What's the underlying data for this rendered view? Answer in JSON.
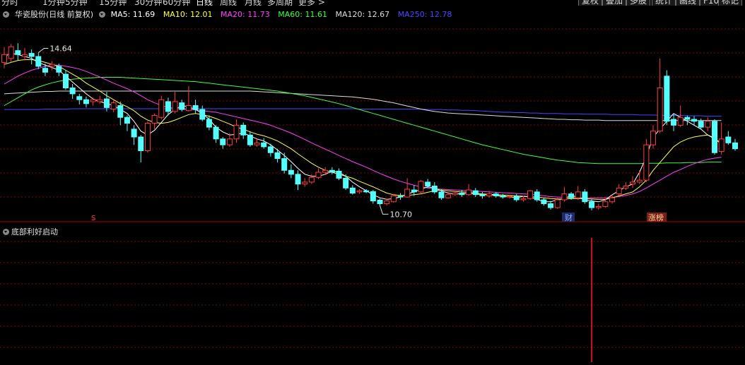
{
  "toolbar": {
    "tabs": [
      {
        "label": "分时",
        "active": false
      },
      {
        "label": "1分钟",
        "active": false
      },
      {
        "label": "5分钟",
        "active": false
      },
      {
        "label": "15分钟",
        "active": false
      },
      {
        "label": "30分钟",
        "active": false
      },
      {
        "label": "60分钟",
        "active": false
      },
      {
        "label": "日线",
        "active": true
      },
      {
        "label": "周线",
        "active": false
      },
      {
        "label": "月线",
        "active": false
      },
      {
        "label": "多周期",
        "active": false
      },
      {
        "label": "更多",
        "active": false
      }
    ],
    "right_buttons": [
      "复权",
      "叠加",
      "多股",
      "统计",
      "画线",
      "F10",
      "标记"
    ]
  },
  "legend": {
    "title": "华瓷股份(日线 前复权)",
    "ma5": "MA5: 11.69",
    "ma10": "MA10: 12.01",
    "ma20": "MA20: 11.73",
    "ma60": "MA60: 11.61",
    "ma120": "MA120: 12.67",
    "ma250": "MA250: 12.78"
  },
  "colors": {
    "up": "#ff3b3b",
    "down": "#54ffff",
    "ma5": "#ffffff",
    "ma10": "#ffff3c",
    "ma20": "#ff3cff",
    "ma60": "#3cff3c",
    "ma120": "#dcdcdc",
    "ma250": "#4646ff",
    "grid": "#8b0000"
  },
  "annotations": {
    "high_label": "14.64",
    "low_label": "10.70",
    "marker_s": "S",
    "marker_cai": "财",
    "marker_zhangting": "涨榜"
  },
  "indicator": {
    "title": "底部利好启动"
  },
  "chart_data": {
    "type": "candlestick",
    "y_range": [
      10.2,
      15.2
    ],
    "candles": [
      [
        14.15,
        14.35,
        14.54,
        14.0
      ],
      [
        14.25,
        14.55,
        14.62,
        14.15
      ],
      [
        14.45,
        14.35,
        14.64,
        14.2
      ],
      [
        14.3,
        14.35,
        14.52,
        14.2
      ],
      [
        14.38,
        14.3,
        14.48,
        14.1
      ],
      [
        14.3,
        14.05,
        14.4,
        13.98
      ],
      [
        14.0,
        13.9,
        14.12,
        13.8
      ],
      [
        14.05,
        14.1,
        14.18,
        13.95
      ],
      [
        14.05,
        13.9,
        14.12,
        13.8
      ],
      [
        13.85,
        13.5,
        13.95,
        13.45
      ],
      [
        13.5,
        13.35,
        13.6,
        13.22
      ],
      [
        13.28,
        13.2,
        13.35,
        13.08
      ],
      [
        13.2,
        13.1,
        13.28,
        13.0
      ],
      [
        13.15,
        13.2,
        13.25,
        13.05
      ],
      [
        13.15,
        13.2,
        13.3,
        13.1
      ],
      [
        13.22,
        13.0,
        13.4,
        12.9
      ],
      [
        12.96,
        13.12,
        13.18,
        12.88
      ],
      [
        13.05,
        12.75,
        13.15,
        12.55
      ],
      [
        12.75,
        12.6,
        12.8,
        12.4
      ],
      [
        12.45,
        12.25,
        12.55,
        12.05
      ],
      [
        12.25,
        11.9,
        12.3,
        11.6
      ],
      [
        11.9,
        12.6,
        12.65,
        11.85
      ],
      [
        12.6,
        12.8,
        12.85,
        12.45
      ],
      [
        12.75,
        13.2,
        13.3,
        12.7
      ],
      [
        13.15,
        12.9,
        13.25,
        12.8
      ],
      [
        12.9,
        13.15,
        13.4,
        12.85
      ],
      [
        13.12,
        12.95,
        13.2,
        12.9
      ],
      [
        12.92,
        13.05,
        13.55,
        12.9
      ],
      [
        13.05,
        12.95,
        13.2,
        12.85
      ],
      [
        12.95,
        12.7,
        13.05,
        12.65
      ],
      [
        12.7,
        12.5,
        12.8,
        12.42
      ],
      [
        12.5,
        12.2,
        12.55,
        12.1
      ],
      [
        12.2,
        12.05,
        12.25,
        11.95
      ],
      [
        12.05,
        12.2,
        12.35,
        12.0
      ],
      [
        12.2,
        12.55,
        12.7,
        12.1
      ],
      [
        12.55,
        12.3,
        12.62,
        12.2
      ],
      [
        12.3,
        12.05,
        12.4,
        12.0
      ],
      [
        12.05,
        12.1,
        12.2,
        12.0
      ],
      [
        12.1,
        12.0,
        12.22,
        11.95
      ],
      [
        12.0,
        11.85,
        12.08,
        11.75
      ],
      [
        11.85,
        11.7,
        11.95,
        11.6
      ],
      [
        11.7,
        11.4,
        11.85,
        11.32
      ],
      [
        11.4,
        11.3,
        11.55,
        11.2
      ],
      [
        11.3,
        11.05,
        11.4,
        10.9
      ],
      [
        11.05,
        11.1,
        11.2,
        10.98
      ],
      [
        11.1,
        11.22,
        11.3,
        11.05
      ],
      [
        11.22,
        11.35,
        11.45,
        11.18
      ],
      [
        11.35,
        11.4,
        11.48,
        11.28
      ],
      [
        11.4,
        11.35,
        11.48,
        11.3
      ],
      [
        11.38,
        11.2,
        11.45,
        11.15
      ],
      [
        11.2,
        10.95,
        11.3,
        10.9
      ],
      [
        10.95,
        10.82,
        11.02,
        10.78
      ],
      [
        10.85,
        10.88,
        10.92,
        10.8
      ],
      [
        10.88,
        10.85,
        10.92,
        10.82
      ],
      [
        10.86,
        10.62,
        10.9,
        10.55
      ],
      [
        10.64,
        10.55,
        10.68,
        10.5
      ],
      [
        10.55,
        10.62,
        10.68,
        10.5
      ],
      [
        10.6,
        10.75,
        10.8,
        10.58
      ],
      [
        10.74,
        10.72,
        10.82,
        10.65
      ],
      [
        10.72,
        10.92,
        11.2,
        10.7
      ],
      [
        10.9,
        10.85,
        11.02,
        10.75
      ],
      [
        10.85,
        11.12,
        11.15,
        10.8
      ],
      [
        11.1,
        11.0,
        11.18,
        10.95
      ],
      [
        11.0,
        10.85,
        11.1,
        10.8
      ],
      [
        10.85,
        10.7,
        10.92,
        10.65
      ],
      [
        10.7,
        10.78,
        10.85,
        10.68
      ],
      [
        10.78,
        10.82,
        10.88,
        10.75
      ],
      [
        10.82,
        10.78,
        10.9,
        10.72
      ],
      [
        10.78,
        10.9,
        11.05,
        10.75
      ],
      [
        10.88,
        10.78,
        10.95,
        10.72
      ],
      [
        10.78,
        10.75,
        10.85,
        10.68
      ],
      [
        10.75,
        10.8,
        10.88,
        10.7
      ],
      [
        10.8,
        10.75,
        10.85,
        10.7
      ],
      [
        10.75,
        10.72,
        10.8,
        10.68
      ],
      [
        10.72,
        10.74,
        10.78,
        10.68
      ],
      [
        10.74,
        10.65,
        10.8,
        10.6
      ],
      [
        10.65,
        10.68,
        10.75,
        10.6
      ],
      [
        10.68,
        10.88,
        10.9,
        10.65
      ],
      [
        10.85,
        10.65,
        10.92,
        10.6
      ],
      [
        10.65,
        10.55,
        10.7,
        10.5
      ],
      [
        10.55,
        10.45,
        10.62,
        10.4
      ],
      [
        10.45,
        10.65,
        10.7,
        10.42
      ],
      [
        10.65,
        10.8,
        10.98,
        10.6
      ],
      [
        10.8,
        10.7,
        10.85,
        10.65
      ],
      [
        10.7,
        10.85,
        11.0,
        10.65
      ],
      [
        10.85,
        10.6,
        10.92,
        10.55
      ],
      [
        10.6,
        10.45,
        10.68,
        10.38
      ],
      [
        10.45,
        10.48,
        10.55,
        10.4
      ],
      [
        10.48,
        10.6,
        10.68,
        10.45
      ],
      [
        10.6,
        10.7,
        10.78,
        10.55
      ],
      [
        10.8,
        10.95,
        11.05,
        10.75
      ],
      [
        10.95,
        11.0,
        11.1,
        10.9
      ],
      [
        11.05,
        11.1,
        11.25,
        10.95
      ],
      [
        11.1,
        11.15,
        11.4,
        11.05
      ],
      [
        11.15,
        12.05,
        12.2,
        11.1
      ],
      [
        12.05,
        12.4,
        12.55,
        11.95
      ],
      [
        12.4,
        13.5,
        14.25,
        12.35
      ],
      [
        13.8,
        12.65,
        13.95,
        12.55
      ],
      [
        12.7,
        12.55,
        12.85,
        12.4
      ],
      [
        12.55,
        12.75,
        13.05,
        12.5
      ],
      [
        12.75,
        12.7,
        12.8,
        12.55
      ],
      [
        12.7,
        12.65,
        12.78,
        12.55
      ],
      [
        12.65,
        12.5,
        12.72,
        12.45
      ],
      [
        12.5,
        12.65,
        12.75,
        12.4
      ],
      [
        12.65,
        11.85,
        12.7,
        11.8
      ],
      [
        11.88,
        12.2,
        12.62,
        11.8
      ],
      [
        12.25,
        12.1,
        12.4,
        12.05
      ],
      [
        12.1,
        11.95,
        12.2,
        11.9
      ]
    ],
    "ma": {
      "ma5": [
        14.3,
        14.38,
        14.35,
        14.3,
        14.25,
        14.15,
        14.08,
        14.02,
        13.95,
        13.8,
        13.65,
        13.5,
        13.35,
        13.22,
        13.15,
        13.1,
        13.05,
        12.95,
        12.85,
        12.65,
        12.4,
        12.3,
        12.42,
        12.62,
        12.82,
        12.95,
        13.05,
        13.02,
        12.95,
        12.85,
        12.7,
        12.5,
        12.38,
        12.3,
        12.32,
        12.35,
        12.28,
        12.2,
        12.15,
        12.05,
        11.92,
        11.78,
        11.62,
        11.45,
        11.3,
        11.25,
        11.25,
        11.3,
        11.38,
        11.35,
        11.25,
        11.1,
        10.98,
        10.88,
        10.78,
        10.7,
        10.66,
        10.68,
        10.72,
        10.8,
        10.85,
        10.92,
        10.98,
        10.95,
        10.88,
        10.82,
        10.8,
        10.8,
        10.82,
        10.8,
        10.78,
        10.78,
        10.76,
        10.74,
        10.72,
        10.7,
        10.74,
        10.72,
        10.66,
        10.6,
        10.6,
        10.65,
        10.68,
        10.76,
        10.72,
        10.65,
        10.62,
        10.6,
        10.65,
        10.78,
        10.88,
        10.98,
        11.05,
        11.35,
        11.75,
        12.25,
        12.45,
        12.65,
        12.85,
        12.75,
        12.65,
        12.55,
        12.45,
        12.3,
        12.2,
        12.1
      ],
      "ma10": [
        14.1,
        14.15,
        14.2,
        14.22,
        14.22,
        14.2,
        14.15,
        14.1,
        14.05,
        13.95,
        13.85,
        13.75,
        13.62,
        13.52,
        13.42,
        13.3,
        13.2,
        13.1,
        13.02,
        12.92,
        12.78,
        12.68,
        12.62,
        12.6,
        12.62,
        12.68,
        12.75,
        12.82,
        12.85,
        12.82,
        12.78,
        12.72,
        12.65,
        12.58,
        12.5,
        12.45,
        12.38,
        12.32,
        12.28,
        12.22,
        12.15,
        12.05,
        11.95,
        11.82,
        11.7,
        11.58,
        11.48,
        11.4,
        11.35,
        11.3,
        11.25,
        11.2,
        11.12,
        11.05,
        10.98,
        10.9,
        10.82,
        10.78,
        10.76,
        10.76,
        10.78,
        10.8,
        10.84,
        10.88,
        10.9,
        10.88,
        10.86,
        10.85,
        10.84,
        10.82,
        10.8,
        10.79,
        10.78,
        10.77,
        10.76,
        10.75,
        10.74,
        10.73,
        10.72,
        10.7,
        10.68,
        10.67,
        10.67,
        10.68,
        10.68,
        10.68,
        10.67,
        10.66,
        10.66,
        10.7,
        10.75,
        10.8,
        10.85,
        10.98,
        11.15,
        11.4,
        11.6,
        11.8,
        12.0,
        12.12,
        12.2,
        12.25,
        12.28,
        12.3,
        12.22,
        12.05
      ],
      "ma20": [
        13.6,
        13.7,
        13.8,
        13.88,
        13.95,
        14.0,
        14.05,
        14.08,
        14.08,
        14.05,
        14.02,
        13.98,
        13.92,
        13.85,
        13.78,
        13.7,
        13.62,
        13.55,
        13.48,
        13.4,
        13.3,
        13.2,
        13.12,
        13.05,
        13.0,
        12.98,
        12.96,
        12.95,
        12.94,
        12.92,
        12.9,
        12.88,
        12.84,
        12.8,
        12.76,
        12.72,
        12.68,
        12.64,
        12.6,
        12.55,
        12.48,
        12.42,
        12.35,
        12.27,
        12.19,
        12.1,
        12.02,
        11.94,
        11.86,
        11.78,
        11.7,
        11.62,
        11.55,
        11.48,
        11.4,
        11.32,
        11.25,
        11.18,
        11.12,
        11.07,
        11.02,
        10.98,
        10.95,
        10.93,
        10.92,
        10.91,
        10.9,
        10.89,
        10.88,
        10.87,
        10.86,
        10.85,
        10.84,
        10.83,
        10.82,
        10.81,
        10.8,
        10.79,
        10.77,
        10.75,
        10.73,
        10.72,
        10.71,
        10.71,
        10.7,
        10.7,
        10.7,
        10.7,
        10.7,
        10.71,
        10.73,
        10.76,
        10.8,
        10.86,
        10.95,
        11.05,
        11.15,
        11.25,
        11.35,
        11.42,
        11.5,
        11.57,
        11.63,
        11.68,
        11.71,
        11.73
      ],
      "ma60": [
        13.05,
        13.15,
        13.25,
        13.35,
        13.45,
        13.52,
        13.58,
        13.63,
        13.67,
        13.7,
        13.72,
        13.74,
        13.75,
        13.76,
        13.77,
        13.77,
        13.77,
        13.77,
        13.76,
        13.75,
        13.74,
        13.73,
        13.72,
        13.71,
        13.7,
        13.69,
        13.68,
        13.67,
        13.66,
        13.64,
        13.62,
        13.6,
        13.58,
        13.56,
        13.54,
        13.52,
        13.5,
        13.48,
        13.46,
        13.44,
        13.42,
        13.39,
        13.36,
        13.33,
        13.3,
        13.26,
        13.22,
        13.18,
        13.14,
        13.1,
        13.05,
        13.0,
        12.95,
        12.9,
        12.85,
        12.8,
        12.75,
        12.7,
        12.65,
        12.6,
        12.55,
        12.5,
        12.45,
        12.4,
        12.35,
        12.3,
        12.25,
        12.2,
        12.15,
        12.1,
        12.05,
        12.01,
        11.97,
        11.93,
        11.89,
        11.85,
        11.81,
        11.78,
        11.75,
        11.72,
        11.69,
        11.66,
        11.64,
        11.62,
        11.6,
        11.59,
        11.58,
        11.57,
        11.57,
        11.57,
        11.57,
        11.57,
        11.57,
        11.57,
        11.58,
        11.58,
        11.58,
        11.59,
        11.59,
        11.59,
        11.6,
        11.6,
        11.6,
        11.61,
        11.61,
        11.61
      ],
      "ma120": [
        13.35,
        13.36,
        13.37,
        13.38,
        13.39,
        13.4,
        13.41,
        13.41,
        13.42,
        13.42,
        13.42,
        13.42,
        13.42,
        13.42,
        13.42,
        13.42,
        13.42,
        13.42,
        13.42,
        13.42,
        13.42,
        13.42,
        13.42,
        13.42,
        13.42,
        13.42,
        13.42,
        13.42,
        13.42,
        13.42,
        13.42,
        13.42,
        13.42,
        13.42,
        13.42,
        13.42,
        13.42,
        13.41,
        13.4,
        13.39,
        13.38,
        13.37,
        13.36,
        13.35,
        13.34,
        13.33,
        13.32,
        13.31,
        13.3,
        13.29,
        13.28,
        13.27,
        13.25,
        13.23,
        13.21,
        13.18,
        13.15,
        13.12,
        13.08,
        13.04,
        13.0,
        12.96,
        12.93,
        12.9,
        12.88,
        12.86,
        12.85,
        12.84,
        12.83,
        12.82,
        12.81,
        12.8,
        12.79,
        12.78,
        12.77,
        12.76,
        12.75,
        12.74,
        12.73,
        12.72,
        12.71,
        12.7,
        12.7,
        12.69,
        12.69,
        12.68,
        12.68,
        12.68,
        12.67,
        12.67,
        12.67,
        12.67,
        12.67,
        12.67,
        12.67,
        12.67,
        12.67,
        12.67,
        12.67,
        12.67,
        12.67,
        12.67,
        12.67,
        12.67,
        12.67,
        12.67
      ],
      "ma250": [
        12.95,
        12.95,
        12.95,
        12.95,
        12.95,
        12.95,
        12.96,
        12.96,
        12.96,
        12.96,
        12.97,
        12.97,
        12.97,
        12.97,
        12.97,
        12.97,
        12.97,
        12.97,
        12.97,
        12.97,
        12.97,
        12.97,
        12.97,
        12.97,
        12.97,
        12.97,
        12.97,
        12.97,
        12.97,
        12.97,
        12.97,
        12.97,
        12.97,
        12.97,
        12.97,
        12.97,
        12.97,
        12.97,
        12.97,
        12.97,
        12.97,
        12.97,
        12.97,
        12.97,
        12.97,
        12.97,
        12.97,
        12.97,
        12.97,
        12.97,
        12.97,
        12.97,
        12.96,
        12.96,
        12.96,
        12.96,
        12.96,
        12.96,
        12.96,
        12.96,
        12.96,
        12.96,
        12.95,
        12.95,
        12.95,
        12.94,
        12.94,
        12.93,
        12.93,
        12.92,
        12.91,
        12.9,
        12.89,
        12.88,
        12.88,
        12.87,
        12.87,
        12.86,
        12.86,
        12.85,
        12.85,
        12.85,
        12.84,
        12.84,
        12.84,
        12.83,
        12.83,
        12.83,
        12.83,
        12.82,
        12.82,
        12.82,
        12.82,
        12.81,
        12.81,
        12.81,
        12.8,
        12.8,
        12.8,
        12.8,
        12.79,
        12.79,
        12.79,
        12.78,
        12.78,
        12.78
      ]
    },
    "high_index": 5,
    "low_index": 55,
    "signal_index": 86
  }
}
